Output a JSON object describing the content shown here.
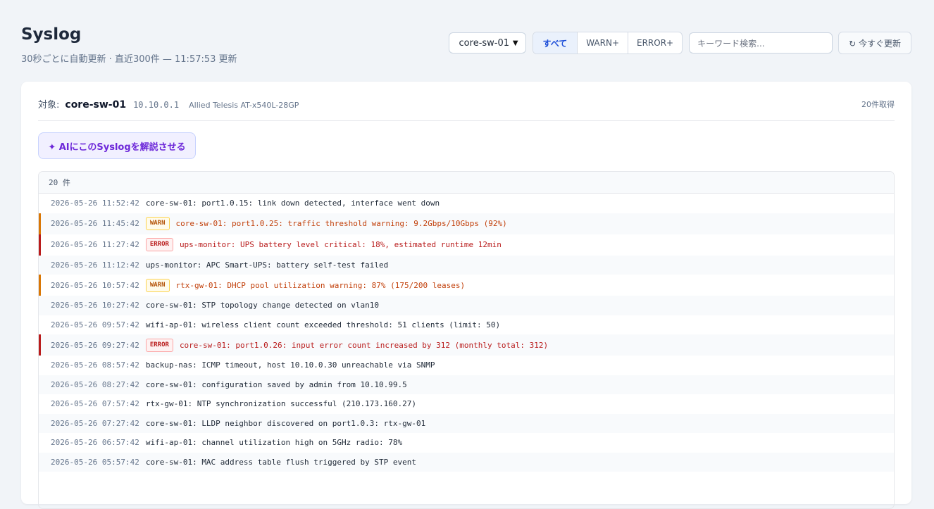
{
  "header": {
    "title": "Syslog",
    "subtitle": "30秒ごとに自動更新 · 直近300件 — 11:57:53 更新"
  },
  "controls": {
    "device_select": "core-sw-01",
    "filters": [
      "すべて",
      "WARN+",
      "ERROR+"
    ],
    "search_placeholder": "キーワード検索...",
    "refresh_label": "↻ 今すぐ更新"
  },
  "card": {
    "target_label": "対象:",
    "host": "core-sw-01",
    "ip": "10.10.0.1",
    "model": "Allied Telesis AT-x540L-28GP",
    "fetched": "20件取得",
    "ai_button": "✦ AIにこのSyslogを解説させる",
    "list_count": "20 件"
  },
  "logs": [
    {
      "ts": "2026-05-26 11:52:42",
      "level": "",
      "msg": "core-sw-01: port1.0.15: link down detected, interface went down"
    },
    {
      "ts": "2026-05-26 11:45:42",
      "level": "WARN",
      "msg": "core-sw-01: port1.0.25: traffic threshold warning: 9.2Gbps/10Gbps (92%)"
    },
    {
      "ts": "2026-05-26 11:27:42",
      "level": "ERROR",
      "msg": "ups-monitor: UPS battery level critical: 18%, estimated runtime 12min"
    },
    {
      "ts": "2026-05-26 11:12:42",
      "level": "",
      "msg": "ups-monitor: APC Smart-UPS: battery self-test failed"
    },
    {
      "ts": "2026-05-26 10:57:42",
      "level": "WARN",
      "msg": "rtx-gw-01: DHCP pool utilization warning: 87% (175/200 leases)"
    },
    {
      "ts": "2026-05-26 10:27:42",
      "level": "",
      "msg": "core-sw-01: STP topology change detected on vlan10"
    },
    {
      "ts": "2026-05-26 09:57:42",
      "level": "",
      "msg": "wifi-ap-01: wireless client count exceeded threshold: 51 clients (limit: 50)"
    },
    {
      "ts": "2026-05-26 09:27:42",
      "level": "ERROR",
      "msg": "core-sw-01: port1.0.26: input error count increased by 312 (monthly total: 312)"
    },
    {
      "ts": "2026-05-26 08:57:42",
      "level": "",
      "msg": "backup-nas: ICMP timeout, host 10.10.0.30 unreachable via SNMP"
    },
    {
      "ts": "2026-05-26 08:27:42",
      "level": "",
      "msg": "core-sw-01: configuration saved by admin from 10.10.99.5"
    },
    {
      "ts": "2026-05-26 07:57:42",
      "level": "",
      "msg": "rtx-gw-01: NTP synchronization successful (210.173.160.27)"
    },
    {
      "ts": "2026-05-26 07:27:42",
      "level": "",
      "msg": "core-sw-01: LLDP neighbor discovered on port1.0.3: rtx-gw-01"
    },
    {
      "ts": "2026-05-26 06:57:42",
      "level": "",
      "msg": "wifi-ap-01: channel utilization high on 5GHz radio: 78%"
    },
    {
      "ts": "2026-05-26 05:57:42",
      "level": "",
      "msg": "core-sw-01: MAC address table flush triggered by STP event"
    }
  ],
  "colors": {
    "accent": "#1d4ed8",
    "warn": "#d97706",
    "error": "#b91c1c",
    "ai": "#6d28d9"
  }
}
